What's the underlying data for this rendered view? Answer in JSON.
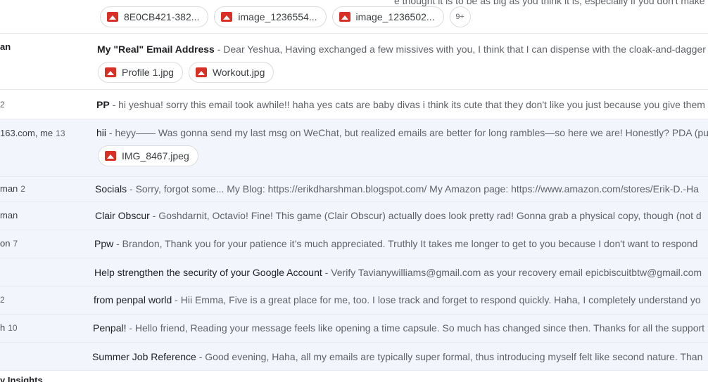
{
  "top_partial": {
    "snippet_fragment": "e thought it is to be as big as you think it is, especially if you don't make any",
    "attachments": [
      "8E0CB421-382...",
      "image_1236554...",
      "image_1236502..."
    ],
    "more": "9+"
  },
  "emails": [
    {
      "sender": "an",
      "count": "",
      "subject": "My \"Real\" Email Address",
      "snippet": " - Dear Yeshua, Having exchanged a few missives with you, I think that I can dispense with the cloak-and-dagger",
      "attachments": [
        "Profile 1.jpg",
        "Workout.jpg"
      ]
    },
    {
      "sender": "",
      "count": "2",
      "subject": "PP",
      "snippet": " - hi yeshua! sorry this email took awhile!! haha yes cats are baby divas i think its cute that they don't like you just because you give them",
      "attachments": []
    },
    {
      "sender": "163.com, me",
      "count": "13",
      "subject": "hii",
      "snippet": " - heyy—— Was gonna send my last msg on WeChat, but realized emails are better for long rambles—so here we are! Honestly? PDA (pu",
      "attachments": [
        "IMG_8467.jpeg"
      ]
    },
    {
      "sender": "man",
      "count": "2",
      "subject": "Socials",
      "snippet": " - Sorry, forgot some... My Blog: https://erikdharshman.blogspot.com/ My Amazon page: https://www.amazon.com/stores/Erik-D.-Ha",
      "attachments": []
    },
    {
      "sender": "man",
      "count": "",
      "subject": "Clair Obscur",
      "snippet": " - Goshdarnit, Octavio! Fine! This game (Clair Obscur) actually does look pretty rad! Gonna grab a physical copy, though (not d",
      "attachments": []
    },
    {
      "sender": "on",
      "count": "7",
      "subject": "Ppw",
      "snippet": " - Brandon, Thank you for your patience it’s much appreciated. Truthly It takes me longer to get to you because I don't want to respond",
      "attachments": []
    },
    {
      "sender": "",
      "count": "",
      "subject": "Help strengthen the security of your Google Account",
      "snippet": " - Verify Tavianywilliams@gmail.com as your recovery email epicbiscuitbtw@gmail.com",
      "attachments": []
    },
    {
      "sender": "",
      "count": "2",
      "subject": "from penpal world",
      "snippet": " - Hii Emma, Five is a great place for me, too. I lose track and forget to respond quickly. Haha, I completely understand yo",
      "attachments": []
    },
    {
      "sender": "h",
      "count": "10",
      "subject": "Penpal!",
      "snippet": " - Hello friend, Reading your message feels like opening a time capsule. So much has changed since then. Thanks for all the support",
      "attachments": []
    },
    {
      "sender": "",
      "count": "",
      "subject": "Summer Job Reference",
      "snippet": " - Good evening, Haha, all my emails are typically super formal, thus introducing myself felt like second nature. Than",
      "attachments": []
    }
  ],
  "bottom_partial": {
    "sender": "y Insights"
  },
  "colors": {
    "attachment_icon": "#d93025",
    "selected_row": "#f2f6fc"
  }
}
